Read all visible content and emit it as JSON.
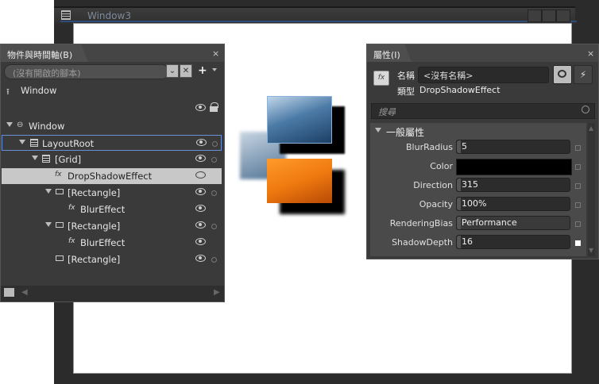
{
  "window": {
    "title": "Window3"
  },
  "objects_panel": {
    "title": "物件與時間軸(B)",
    "close": "×",
    "search_placeholder": "(沒有開啟的腳本)",
    "root_label": "Window",
    "tree": [
      {
        "label": "Window"
      },
      {
        "label": "LayoutRoot"
      },
      {
        "label": "[Grid]"
      },
      {
        "label": "DropShadowEffect"
      },
      {
        "label": "[Rectangle]"
      },
      {
        "label": "BlurEffect"
      },
      {
        "label": "[Rectangle]"
      },
      {
        "label": "BlurEffect"
      },
      {
        "label": "[Rectangle]"
      }
    ]
  },
  "properties_panel": {
    "title": "屬性(I)",
    "close": "×",
    "name_label": "名稱",
    "name_value": "<沒有名稱>",
    "type_label": "類型",
    "type_value": "DropShadowEffect",
    "search_placeholder": "搜尋",
    "category": "一般屬性",
    "properties": [
      {
        "name": "BlurRadius",
        "value": "5"
      },
      {
        "name": "Color",
        "value": ""
      },
      {
        "name": "Direction",
        "value": "315"
      },
      {
        "name": "Opacity",
        "value": "100%"
      },
      {
        "name": "RenderingBias",
        "value": "Performance"
      },
      {
        "name": "ShadowDepth",
        "value": "16"
      }
    ]
  },
  "colors": {
    "selection_row": "#c8c8c8",
    "blue_rect": "#2b5a8a",
    "orange_rect": "#f07a10",
    "panel_bg": "#3a3a3a"
  }
}
